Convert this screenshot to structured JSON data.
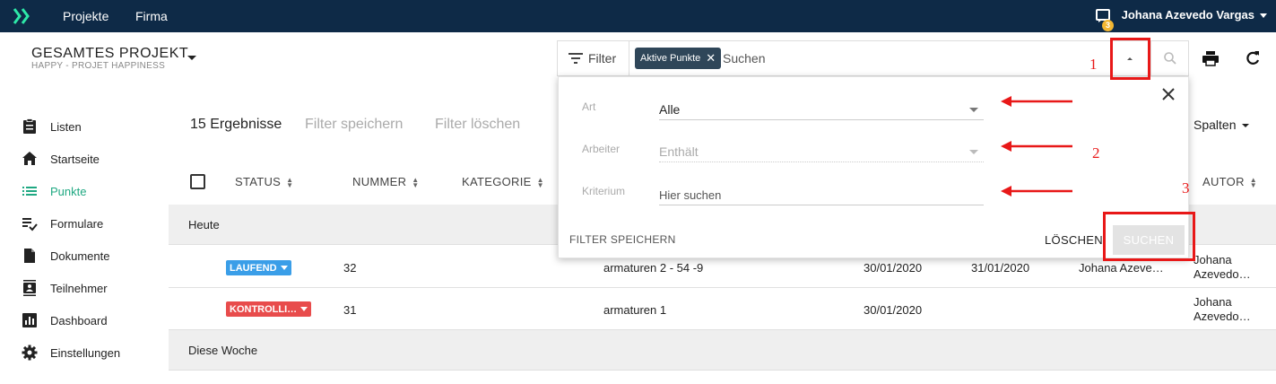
{
  "topbar": {
    "nav": [
      "Projekte",
      "Firma"
    ],
    "user_name": "Johana Azevedo Vargas",
    "notification_count": "3"
  },
  "project": {
    "title": "GESAMTES PROJEKT",
    "subtitle": "HAPPY - PROJET HAPPINESS"
  },
  "filterbar": {
    "filter_label": "Filter",
    "chip_label": "Aktive Punkte",
    "search_placeholder": "Suchen"
  },
  "sidebar": {
    "items": [
      {
        "label": "Listen",
        "icon": "clipboard-icon"
      },
      {
        "label": "Startseite",
        "icon": "home-icon"
      },
      {
        "label": "Punkte",
        "icon": "list-icon",
        "active": true
      },
      {
        "label": "Formulare",
        "icon": "checklist-icon"
      },
      {
        "label": "Dokumente",
        "icon": "document-icon"
      },
      {
        "label": "Teilnehmer",
        "icon": "contacts-icon"
      },
      {
        "label": "Dashboard",
        "icon": "chart-icon"
      },
      {
        "label": "Einstellungen",
        "icon": "gear-icon"
      }
    ]
  },
  "main": {
    "results": "15 Ergebnisse",
    "save_filter": "Filter speichern",
    "clear_filter": "Filter löschen",
    "columns_button": "Spalten",
    "columns": [
      "STATUS",
      "NUMMER",
      "KATEGORIE",
      "AUTOR"
    ],
    "groups": [
      "Heute",
      "Diese Woche"
    ],
    "rows": [
      {
        "status": "LAUFEND",
        "status_color": "#3a9ee8",
        "number": "32",
        "title": "armaturen 2 - 54 -9",
        "date1": "30/01/2020",
        "date2": "31/01/2020",
        "assignee": "Johana Azeve…",
        "author_line1": "Johana",
        "author_line2": "Azevedo…"
      },
      {
        "status": "KONTROLLI…",
        "status_color": "#e84c4c",
        "number": "31",
        "title": "armaturen 1",
        "date1": "30/01/2020",
        "date2": "",
        "assignee": "",
        "author_line1": "Johana",
        "author_line2": "Azevedo…"
      }
    ]
  },
  "panel": {
    "fields": [
      {
        "label": "Art",
        "value": "Alle"
      },
      {
        "label": "Arbeiter",
        "value": "Enthält"
      },
      {
        "label": "Kriterium",
        "placeholder": "Hier suchen"
      }
    ],
    "save_label": "FILTER SPEICHERN",
    "clear_label": "LÖSCHEN",
    "search_label": "SUCHEN"
  },
  "annotations": [
    "1",
    "2",
    "3"
  ],
  "colors": {
    "topbar": "#0e2a47",
    "accent": "#1fa882",
    "annotation": "#e81818"
  }
}
